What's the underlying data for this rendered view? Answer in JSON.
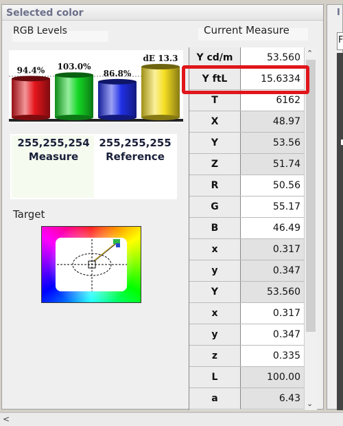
{
  "panel": {
    "title": "Selected color",
    "rgb_label": "RGB Levels",
    "current_measure_label": "Current Measure"
  },
  "bars": [
    {
      "name": "red",
      "percent_label": "94.4%",
      "value": 94.4,
      "color": "#e5151c"
    },
    {
      "name": "green",
      "percent_label": "103.0%",
      "value": 103.0,
      "color": "#15d825"
    },
    {
      "name": "blue",
      "percent_label": "86.8%",
      "value": 86.8,
      "color": "#2130e6"
    },
    {
      "name": "de",
      "percent_label": "dE 13.3",
      "value": 13.3,
      "color": "#f5de22"
    }
  ],
  "values": {
    "measure_rgb": "255,255,254",
    "measure_label": "Measure",
    "reference_rgb": "255,255,255",
    "reference_label": "Reference"
  },
  "target": {
    "label": "Target"
  },
  "measurements": [
    {
      "key": "Y cd/m",
      "value": "53.560"
    },
    {
      "key": "Y ftL",
      "value": "15.6334"
    },
    {
      "key": "T",
      "value": "6162"
    },
    {
      "key": "X",
      "value": "48.97"
    },
    {
      "key": "Y",
      "value": "53.56"
    },
    {
      "key": "Z",
      "value": "51.74"
    },
    {
      "key": "R",
      "value": "50.56"
    },
    {
      "key": "G",
      "value": "55.17"
    },
    {
      "key": "B",
      "value": "46.49"
    },
    {
      "key": "x",
      "value": "0.317"
    },
    {
      "key": "y",
      "value": "0.347"
    },
    {
      "key": "Y",
      "value": "53.560"
    },
    {
      "key": "x",
      "value": "0.317"
    },
    {
      "key": "y",
      "value": "0.347"
    },
    {
      "key": "z",
      "value": "0.335"
    },
    {
      "key": "L",
      "value": "100.00"
    },
    {
      "key": "a",
      "value": "6.43"
    }
  ],
  "right_panel": {
    "title_fragment": "I",
    "field_fragment": "F"
  },
  "colors": {
    "highlight": "#e0161b",
    "panel_bg": "#efefef"
  }
}
